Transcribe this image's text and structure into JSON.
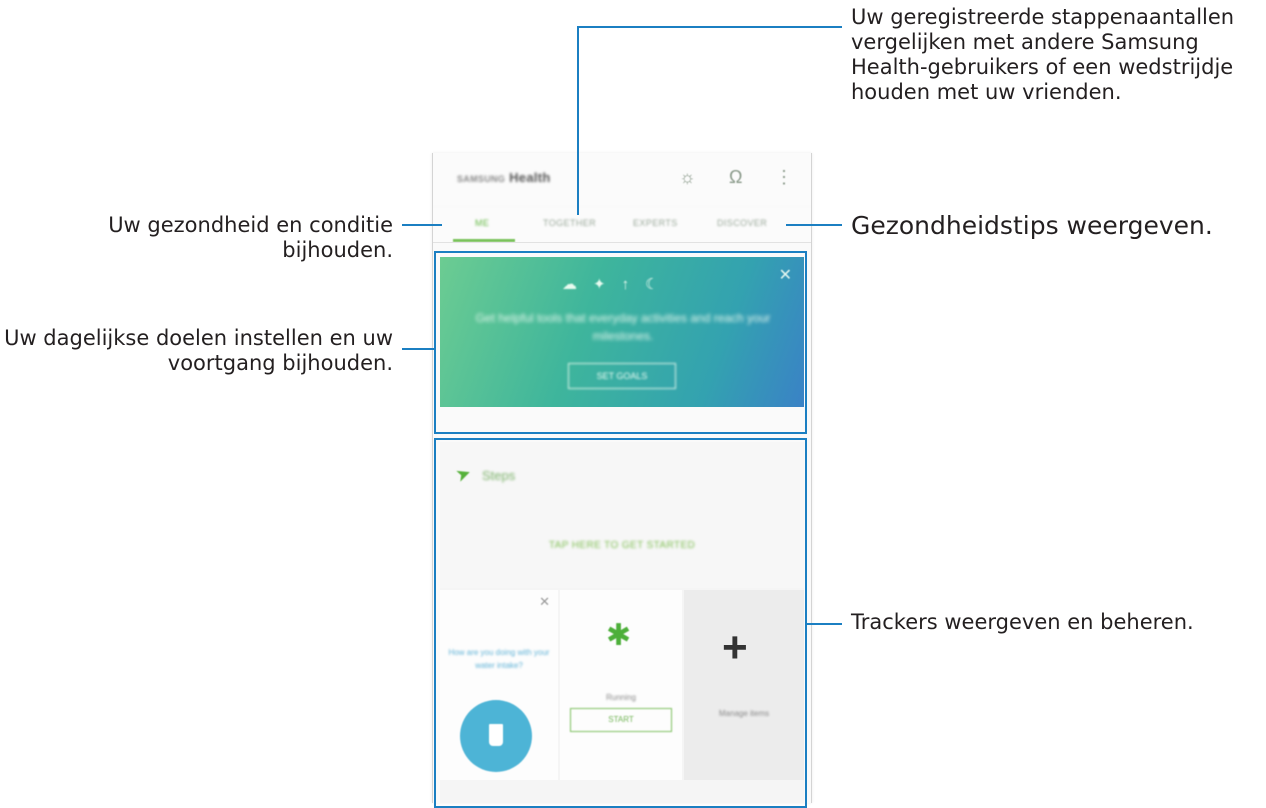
{
  "callouts": {
    "compare": "Uw geregistreerde stappenaantallen vergelijken met andere Samsung Health-gebruikers of een wedstrijdje houden met uw vrienden.",
    "health_tips": "Gezondheidstips weergeven.",
    "track_health": "Uw gezondheid en conditie bijhouden.",
    "daily_goals": "Uw dagelijkse doelen instellen en uw voortgang bijhouden.",
    "trackers": "Trackers weergeven en beheren."
  },
  "colors": {
    "callout_line": "#1b7fc2",
    "accent_green": "#66bb46",
    "goal_gradient_start": "#6ccc92",
    "goal_gradient_end": "#3a82c6",
    "water_blue": "#4db4d6"
  },
  "app": {
    "brand": "SAMSUNG",
    "title": "Health",
    "icons": [
      "lightbulb-icon",
      "headset-icon",
      "more-options-icon"
    ]
  },
  "tabs": [
    {
      "label": "ME",
      "active": true
    },
    {
      "label": "TOGETHER",
      "active": false
    },
    {
      "label": "EXPERTS",
      "active": false
    },
    {
      "label": "DISCOVER",
      "active": false
    }
  ],
  "goal_card": {
    "icons": [
      "activity-icon",
      "running-icon",
      "food-icon",
      "sleep-icon"
    ],
    "text": "Get helpful tools that everyday activities and reach your milestones.",
    "button": "SET GOALS"
  },
  "steps": {
    "label": "Steps",
    "cta": "TAP HERE TO GET STARTED"
  },
  "tiles": {
    "water_question": "How are you doing with your water intake?",
    "running_label": "Running",
    "start_button": "START",
    "manage_label": "Manage items"
  }
}
